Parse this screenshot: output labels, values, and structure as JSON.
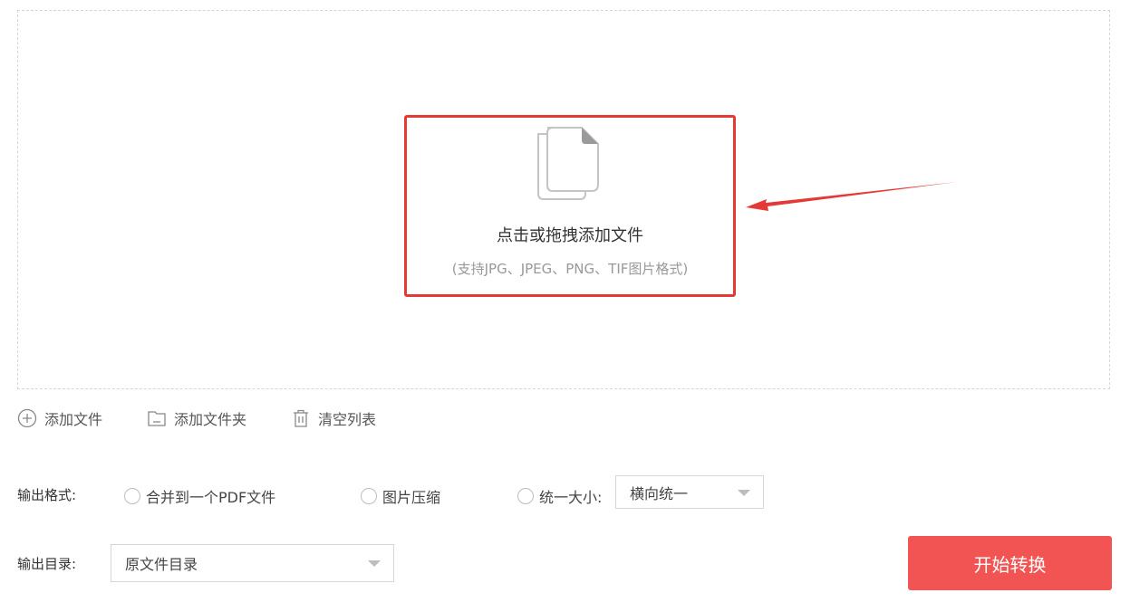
{
  "dropzone": {
    "title": "点击或拖拽添加文件",
    "subtitle": "(支持JPG、JPEG、PNG、TIF图片格式)",
    "icon": "file-stack-icon",
    "highlight_color": "#e53935"
  },
  "toolbar": {
    "add_file": "添加文件",
    "add_folder": "添加文件夹",
    "clear_list": "清空列表"
  },
  "output_format": {
    "label": "输出格式:",
    "options": [
      "合并到一个PDF文件",
      "图片压缩",
      "统一大小:"
    ],
    "size_select": "横向统一"
  },
  "output_dir": {
    "label": "输出目录:",
    "value": "原文件目录"
  },
  "start_button": {
    "label": "开始转换",
    "color": "#f25454"
  }
}
